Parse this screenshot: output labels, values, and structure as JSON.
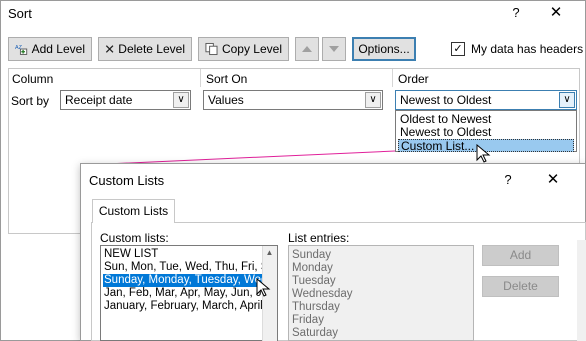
{
  "sort_dialog": {
    "title": "Sort",
    "help": "?",
    "close": "✕",
    "toolbar": {
      "add_level": "Add Level",
      "delete_level": "Delete Level",
      "copy_level": "Copy Level",
      "options": "Options..."
    },
    "headers_checkbox": {
      "checked": true,
      "mark": "✓",
      "label": "My data has headers"
    },
    "columns": {
      "column": "Column",
      "sort_on": "Sort On",
      "order": "Order"
    },
    "row": {
      "label": "Sort by",
      "column_value": "Receipt date",
      "sort_on_value": "Values",
      "order_value": "Newest to Oldest"
    },
    "order_options": [
      "Oldest to Newest",
      "Newest to Oldest",
      "Custom List..."
    ],
    "selected_order_option": 2
  },
  "custom_dialog": {
    "title": "Custom Lists",
    "help": "?",
    "close": "✕",
    "tab": "Custom Lists",
    "lists_label": "Custom lists:",
    "entries_label": "List entries:",
    "lists": [
      "NEW LIST",
      "Sun, Mon, Tue, Wed, Thu, Fri, Sat",
      "Sunday, Monday, Tuesday, Wednesday, Thursday, Friday, Saturday",
      "Jan, Feb, Mar, Apr, May, Jun, Jul, Aug, Sep, Oct, Nov, Dec",
      "January, February, March, April, May, June, July, August"
    ],
    "selected_list": 2,
    "entries": [
      "Sunday",
      "Monday",
      "Tuesday",
      "Wednesday",
      "Thursday",
      "Friday",
      "Saturday"
    ],
    "add_button": "Add",
    "delete_button": "Delete"
  },
  "colors": {
    "accent": "#0078d7",
    "highlight": "#99c9ef",
    "pointer_line": "#e0209a"
  }
}
